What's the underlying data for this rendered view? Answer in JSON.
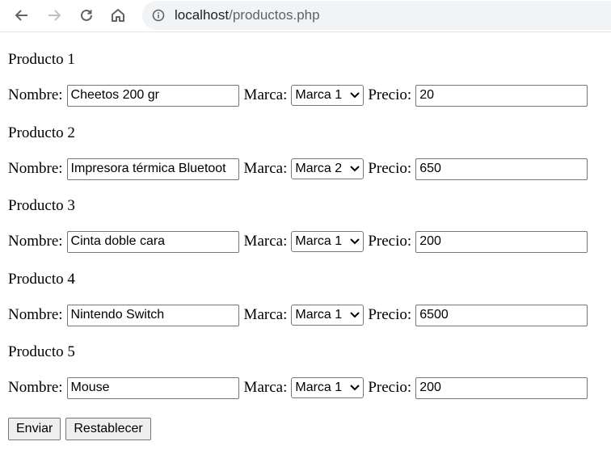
{
  "browser": {
    "url_host": "localhost",
    "url_path": "/productos.php"
  },
  "form": {
    "labels": {
      "name": "Nombre:",
      "brand": "Marca:",
      "price": "Precio:"
    },
    "products": [
      {
        "title": "Producto 1",
        "name": "Cheetos 200 gr",
        "brand": "Marca 1",
        "price": "20"
      },
      {
        "title": "Producto 2",
        "name": "Impresora térmica Bluetoot",
        "brand": "Marca 2",
        "price": "650"
      },
      {
        "title": "Producto 3",
        "name": "Cinta doble cara",
        "brand": "Marca 1",
        "price": "200"
      },
      {
        "title": "Producto 4",
        "name": "Nintendo Switch",
        "brand": "Marca 1",
        "price": "6500"
      },
      {
        "title": "Producto 5",
        "name": "Mouse",
        "brand": "Marca 1",
        "price": "200"
      }
    ],
    "submit_label": "Enviar",
    "reset_label": "Restablecer"
  }
}
